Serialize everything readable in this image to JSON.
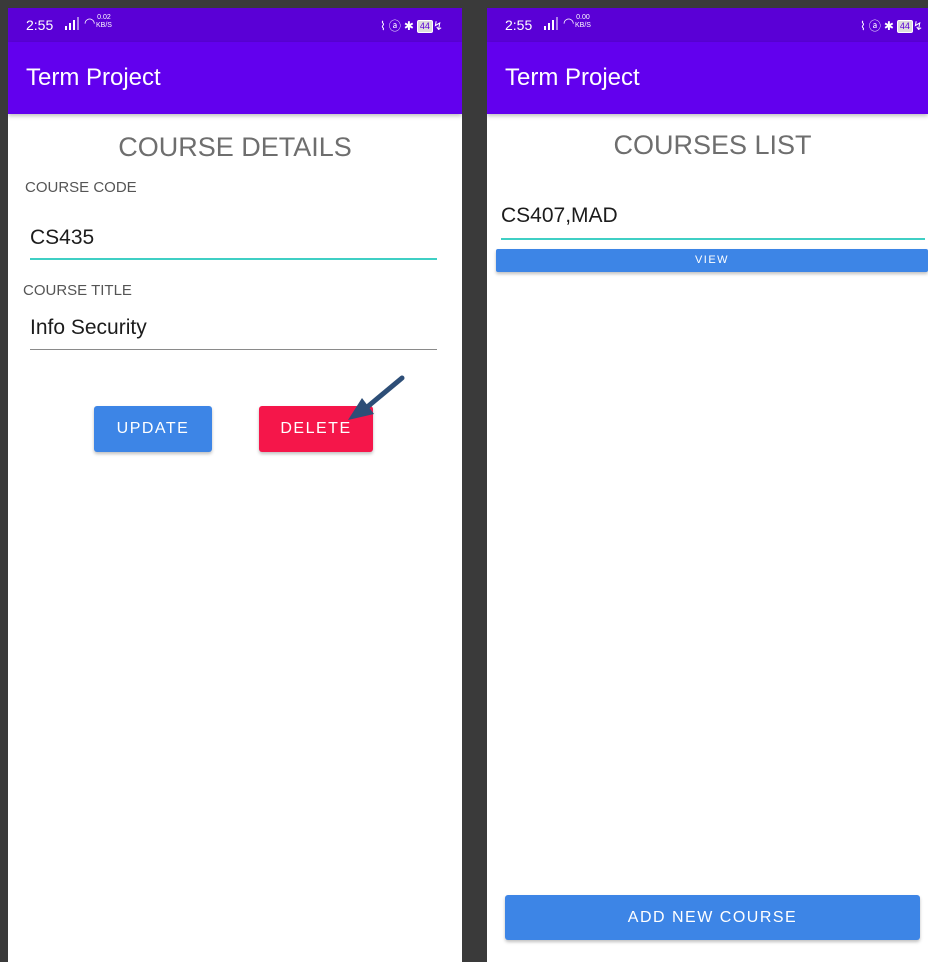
{
  "status_bar": {
    "left": {
      "time": "2:55",
      "speed_value": "0.02",
      "speed_unit": "KB/S"
    },
    "right": {
      "time": "2:55",
      "speed_value": "0.00",
      "speed_unit": "KB/S"
    },
    "battery": "44"
  },
  "app_bar": {
    "title": "Term Project"
  },
  "course_details": {
    "heading": "COURSE DETAILS",
    "code_label": "COURSE CODE",
    "code_value": "CS435",
    "title_label": "COURSE TITLE",
    "title_value": "Info Security",
    "update_label": "UPDATE",
    "delete_label": "DELETE"
  },
  "courses_list": {
    "heading": "COURSES LIST",
    "items": [
      {
        "text": "CS407,MAD",
        "view_label": "VIEW"
      }
    ],
    "add_label": "ADD NEW COURSE"
  },
  "colors": {
    "status_bar": "#5a00d6",
    "app_bar": "#6200ee",
    "primary_button": "#3d85e6",
    "delete_button": "#f5164a",
    "focus_underline": "#3fcfc4",
    "annotation_arrow": "#2d4e77"
  },
  "icons": [
    "signal-icon",
    "wifi-icon",
    "vibrate-icon",
    "alarm-icon",
    "bluetooth-icon",
    "battery-icon",
    "annotation-arrow-icon"
  ]
}
